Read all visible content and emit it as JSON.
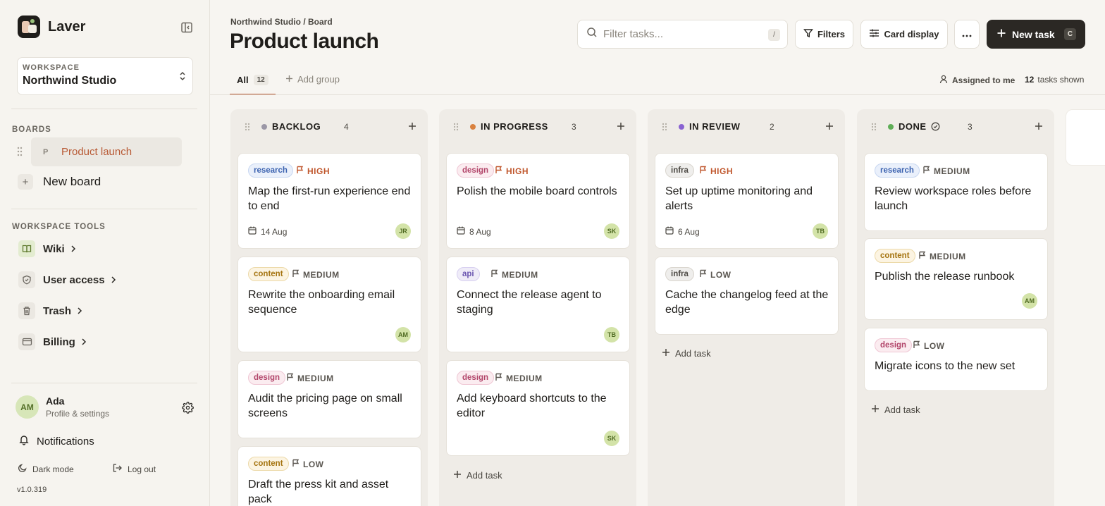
{
  "app": {
    "name": "Laver",
    "version": "v1.0.319"
  },
  "workspace": {
    "label": "WORKSPACE",
    "name": "Northwind Studio"
  },
  "boards_section": {
    "label": "BOARDS",
    "items": [
      {
        "badge": "P",
        "label": "Product launch"
      }
    ],
    "new_board": "New board"
  },
  "tools_section": {
    "label": "WORKSPACE TOOLS",
    "items": [
      {
        "label": "Wiki",
        "icon": "book-icon"
      },
      {
        "label": "User access",
        "icon": "shield-icon"
      },
      {
        "label": "Trash",
        "icon": "trash-icon"
      },
      {
        "label": "Billing",
        "icon": "card-icon"
      }
    ]
  },
  "user": {
    "initials": "AM",
    "name": "Ada",
    "sub": "Profile & settings"
  },
  "notifications": "Notifications",
  "footer": {
    "dark_mode": "Dark mode",
    "log_out": "Log out"
  },
  "header": {
    "breadcrumb": "Northwind Studio / Board",
    "title": "Product launch",
    "search_placeholder": "Filter tasks...",
    "search_shortcut": "/",
    "filters": "Filters",
    "card_display": "Card display",
    "new_task": "New task",
    "new_task_shortcut": "C"
  },
  "tabs": {
    "all": "All",
    "all_count": "12",
    "add_group": "Add group",
    "assigned": "Assigned to me",
    "shown_count": "12",
    "shown_label": "tasks shown"
  },
  "add_task_label": "Add task",
  "colors": {
    "accent": "#b85a35",
    "primary_button": "#2b2824"
  },
  "columns": [
    {
      "name": "BACKLOG",
      "count": "4",
      "dot": "#9b97a6",
      "cards": [
        {
          "tag": "research",
          "priority": "HIGH",
          "title": "Map the first-run experience end to end",
          "date": "14 Aug",
          "assignee": "JR"
        },
        {
          "tag": "content",
          "priority": "MEDIUM",
          "title": "Rewrite the onboarding email sequence",
          "assignee": "AM"
        },
        {
          "tag": "design",
          "priority": "MEDIUM",
          "title": "Audit the pricing page on small screens"
        },
        {
          "tag": "content",
          "priority": "LOW",
          "title": "Draft the press kit and asset pack"
        }
      ]
    },
    {
      "name": "IN PROGRESS",
      "count": "3",
      "dot": "#d9813f",
      "cards": [
        {
          "tag": "design",
          "priority": "HIGH",
          "title": "Polish the mobile board controls",
          "date": "8 Aug",
          "assignee": "SK"
        },
        {
          "tag": "api",
          "priority": "MEDIUM",
          "title": "Connect the release agent to staging",
          "assignee": "TB"
        },
        {
          "tag": "design",
          "priority": "MEDIUM",
          "title": "Add keyboard shortcuts to the editor",
          "assignee": "SK"
        }
      ]
    },
    {
      "name": "IN REVIEW",
      "count": "2",
      "dot": "#8a63d2",
      "cards": [
        {
          "tag": "infra",
          "priority": "HIGH",
          "title": "Set up uptime monitoring and alerts",
          "date": "6 Aug",
          "assignee": "TB"
        },
        {
          "tag": "infra",
          "priority": "LOW",
          "title": "Cache the changelog feed at the edge"
        }
      ]
    },
    {
      "name": "DONE",
      "count": "3",
      "dot": "#5fae57",
      "cards": [
        {
          "tag": "research",
          "priority": "MEDIUM",
          "title": "Review workspace roles before launch"
        },
        {
          "tag": "content",
          "priority": "MEDIUM",
          "title": "Publish the release runbook",
          "assignee": "AM"
        },
        {
          "tag": "design",
          "priority": "LOW",
          "title": "Migrate icons to the new set"
        }
      ]
    }
  ]
}
